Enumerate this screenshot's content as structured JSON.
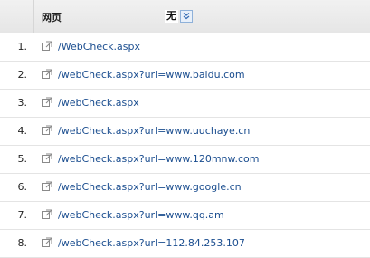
{
  "header": {
    "title": "网页",
    "dimension_value": "无"
  },
  "rows": [
    {
      "index": "1.",
      "url": "/WebCheck.aspx"
    },
    {
      "index": "2.",
      "url": "/webCheck.aspx?url=www.baidu.com"
    },
    {
      "index": "3.",
      "url": "/webCheck.aspx"
    },
    {
      "index": "4.",
      "url": "/webCheck.aspx?url=www.uuchaye.cn"
    },
    {
      "index": "5.",
      "url": "/webCheck.aspx?url=www.120mnw.com"
    },
    {
      "index": "6.",
      "url": "/webCheck.aspx?url=www.google.cn"
    },
    {
      "index": "7.",
      "url": "/webCheck.aspx?url=www.qq.am"
    },
    {
      "index": "8.",
      "url": "/webCheck.aspx?url=112.84.253.107"
    }
  ],
  "icons": {
    "row_link_icon": "external-link-icon",
    "dropdown_icon": "double-chevron-down-icon"
  },
  "colors": {
    "link": "#1a4d8f",
    "header_bg": "#eaeaea",
    "dropdown_border": "#8fb1d9"
  }
}
